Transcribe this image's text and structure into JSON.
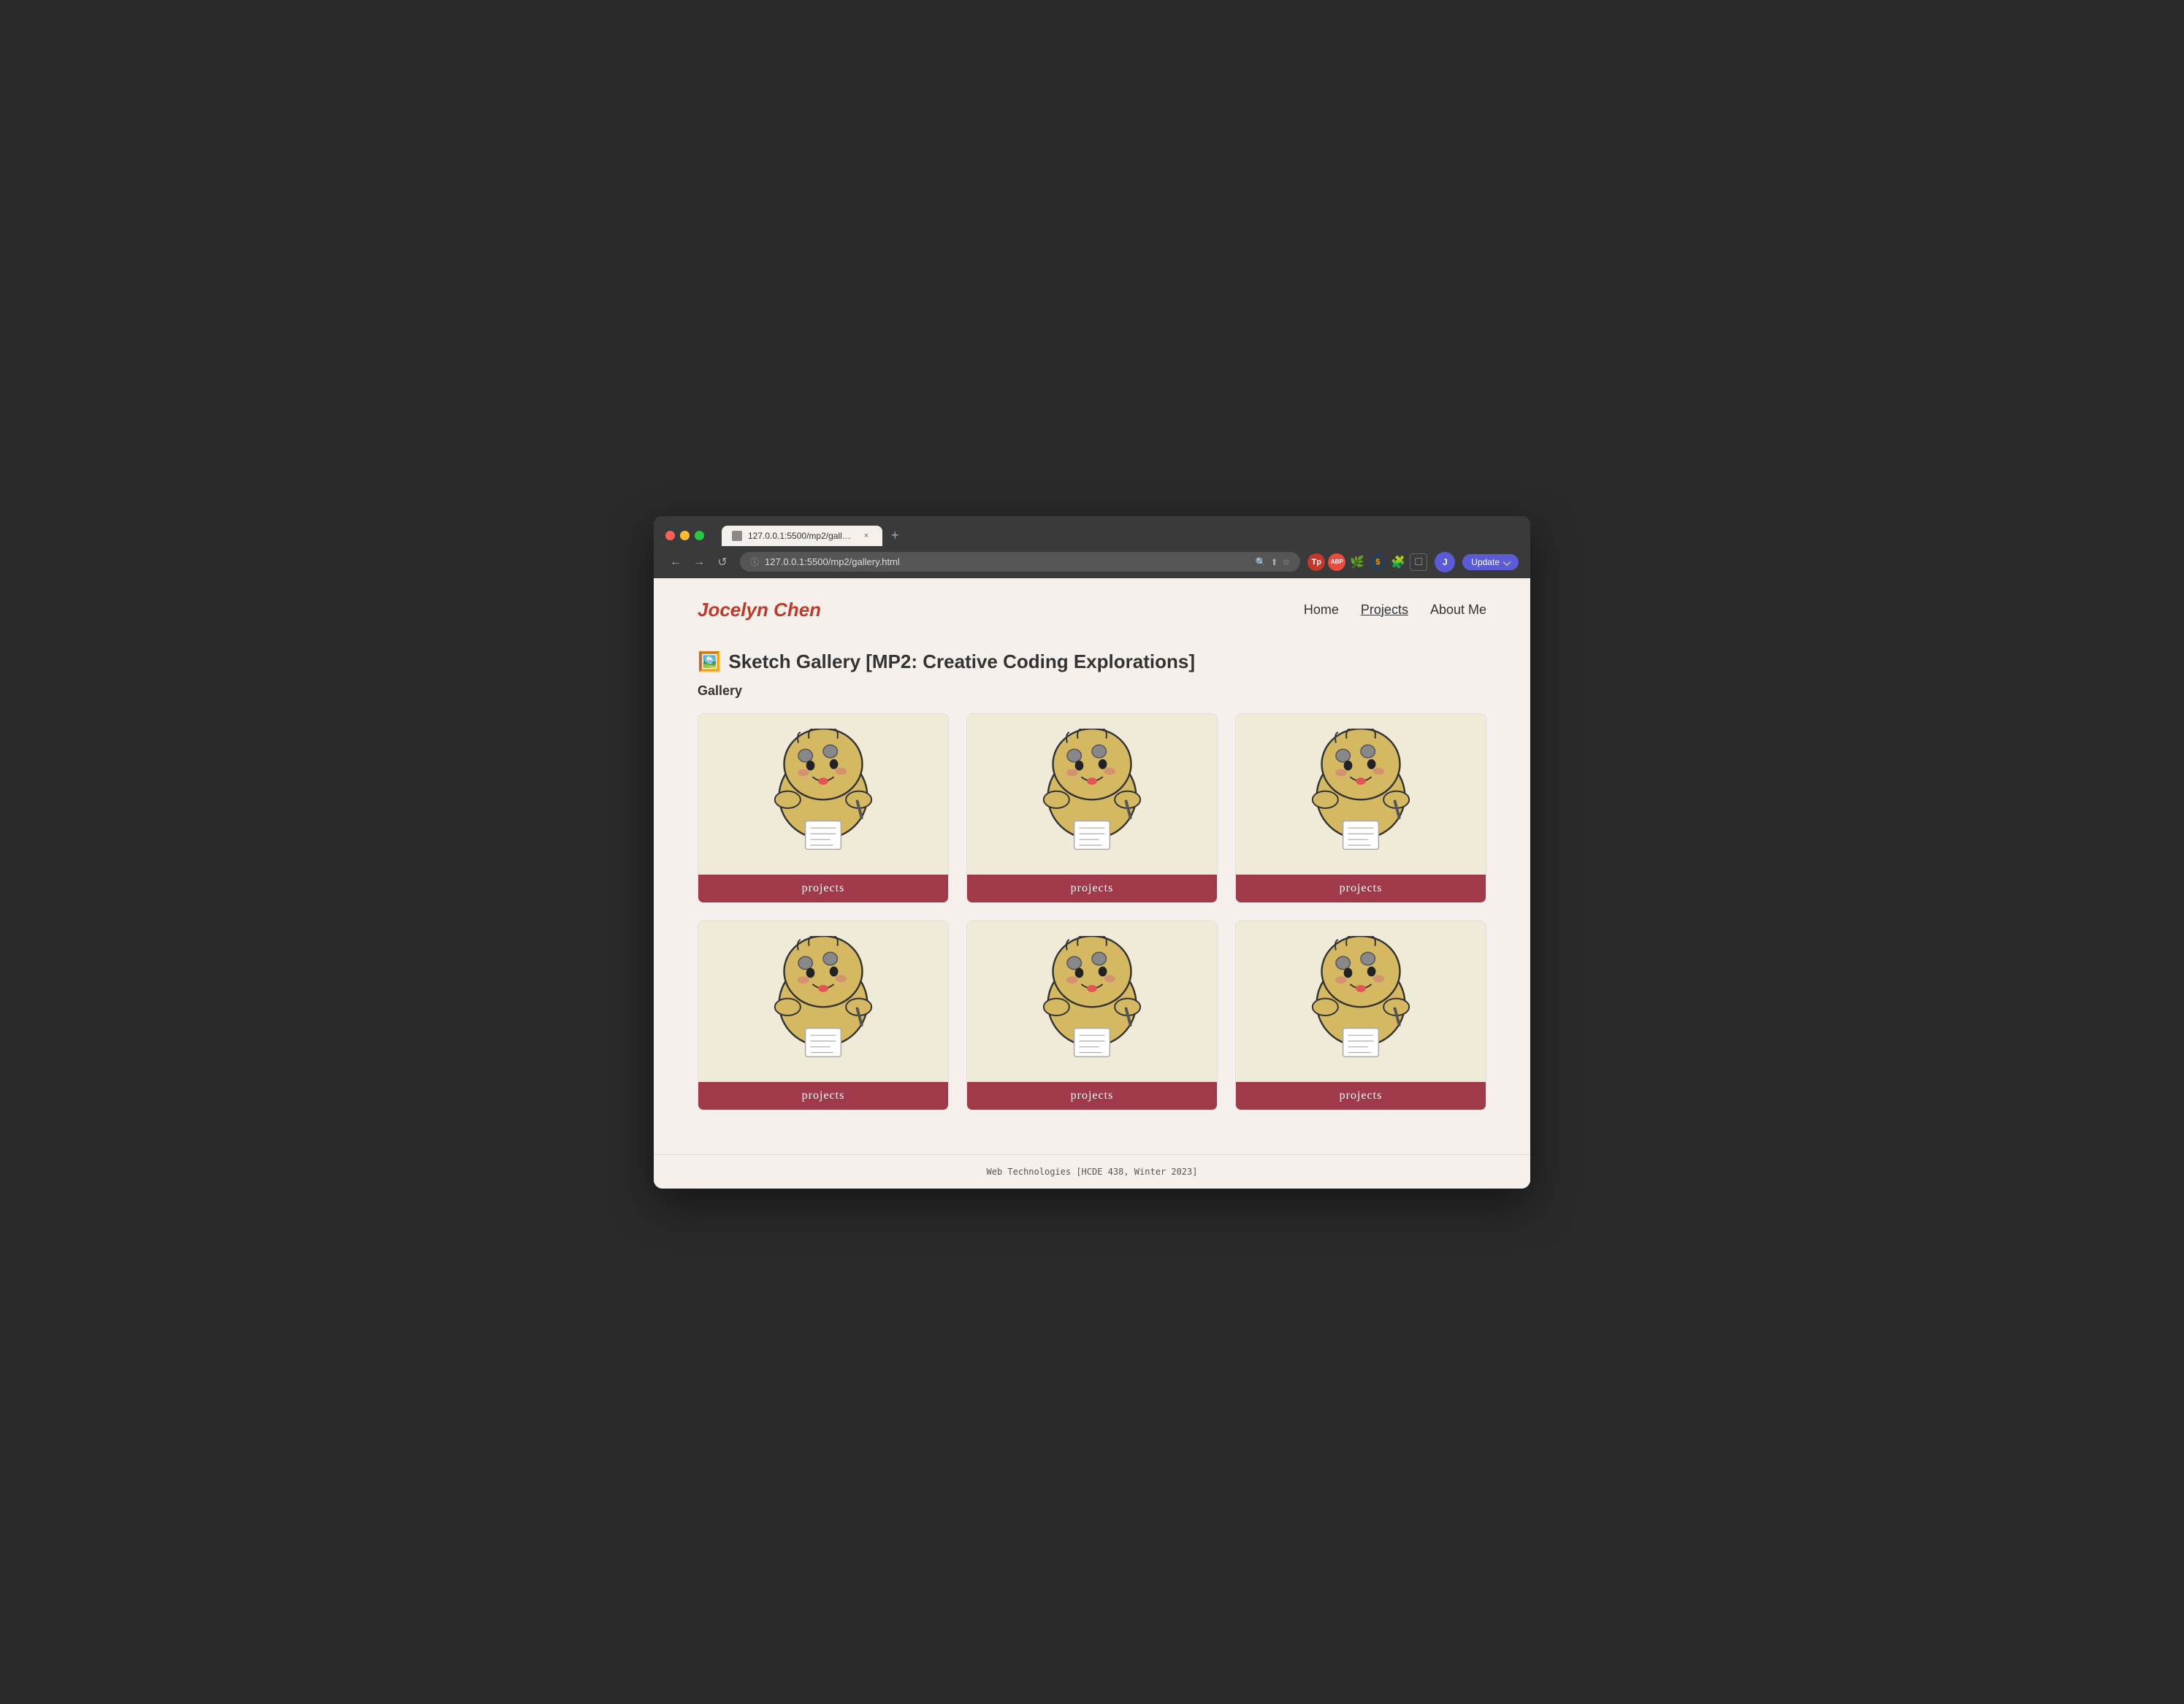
{
  "browser": {
    "tab_title": "127.0.0.1:5500/mp2/gallery.ht...",
    "url": "127.0.0.1:5500/mp2/gallery.html",
    "close_label": "×",
    "new_tab_label": "+",
    "back_label": "←",
    "forward_label": "→",
    "reload_label": "↺",
    "update_label": "Update",
    "profile_label": "J",
    "extensions": [
      {
        "label": "Tp",
        "class": "ext-tp"
      },
      {
        "label": "ABP",
        "class": "ext-abp"
      },
      {
        "label": "🌿",
        "class": "ext-green"
      },
      {
        "label": "$",
        "class": "ext-dollar"
      },
      {
        "label": "🧩",
        "class": "ext-puzzle"
      },
      {
        "label": "□",
        "class": "ext-square"
      }
    ]
  },
  "site": {
    "logo": "Jocelyn Chen",
    "nav": [
      {
        "label": "Home",
        "active": false
      },
      {
        "label": "Projects",
        "active": true
      },
      {
        "label": "About Me",
        "active": false
      }
    ]
  },
  "page": {
    "heading_emoji": "🖼️",
    "heading_text": "Sketch Gallery [MP2: Creative Coding Explorations]",
    "gallery_label": "Gallery",
    "cards": [
      {
        "label": "projects"
      },
      {
        "label": "projects"
      },
      {
        "label": "projects"
      },
      {
        "label": "projects"
      },
      {
        "label": "projects"
      },
      {
        "label": "projects"
      }
    ]
  },
  "footer": {
    "text": "Web Technologies [HCDE 438, Winter 2023]"
  }
}
